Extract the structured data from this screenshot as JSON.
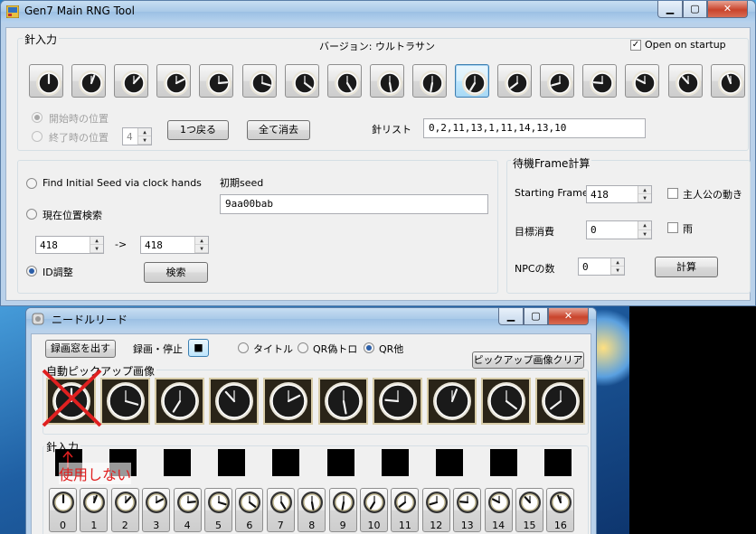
{
  "main_window": {
    "title": "Gen7 Main RNG Tool",
    "caption_min": "▁",
    "caption_max": "▢",
    "caption_close": "✕",
    "needle_group_label": "針入力",
    "version_label": "バージョン: ウルトラサン",
    "open_on_startup_label": "Open on startup",
    "open_on_startup_checked": true,
    "clock_buttons": [
      {
        "index": 0,
        "selected": false
      },
      {
        "index": 1,
        "selected": false
      },
      {
        "index": 2,
        "selected": false
      },
      {
        "index": 3,
        "selected": false
      },
      {
        "index": 4,
        "selected": false
      },
      {
        "index": 5,
        "selected": false
      },
      {
        "index": 6,
        "selected": false
      },
      {
        "index": 7,
        "selected": false
      },
      {
        "index": 8,
        "selected": false
      },
      {
        "index": 9,
        "selected": false
      },
      {
        "index": 10,
        "selected": true
      },
      {
        "index": 11,
        "selected": false
      },
      {
        "index": 12,
        "selected": false
      },
      {
        "index": 13,
        "selected": false
      },
      {
        "index": 14,
        "selected": false
      },
      {
        "index": 15,
        "selected": false
      },
      {
        "index": 16,
        "selected": false
      }
    ],
    "start_position_label": "開始時の位置",
    "end_position_label": "終了時の位置",
    "end_position_value": "4",
    "back_one_button": "1つ戻る",
    "clear_all_button": "全て消去",
    "needle_list_label": "針リスト",
    "needle_list_value": "0,2,11,13,1,11,14,13,10",
    "find_seed_option": "Find Initial Seed via clock hands",
    "current_position_option": "現在位置検索",
    "id_adjust_option": "ID調整",
    "initial_seed_label": "初期seed",
    "initial_seed_value": "9aa00bab",
    "range_from": "418",
    "range_arrow": "->",
    "range_to": "418",
    "search_button": "検索",
    "wait_group_label": "待機Frame計算",
    "starting_frame_label": "Starting Frame",
    "starting_frame_value": "418",
    "target_consumption_label": "目標消費",
    "target_consumption_value": "0",
    "npc_count_label": "NPCの数",
    "npc_count_value": "0",
    "calc_button": "計算",
    "protagonist_motion_label": "主人公の動き",
    "rain_label": "雨"
  },
  "needle_window": {
    "title": "ニードルリード",
    "show_record_window_button": "録画窓を出す",
    "record_toggle_label": "録画・停止",
    "record_toggle_button": "■",
    "mode_options": [
      {
        "label": "タイトル",
        "selected": false
      },
      {
        "label": "QR偽トロ",
        "selected": false
      },
      {
        "label": "QR他",
        "selected": true
      }
    ],
    "clear_pickup_button": "ピックアップ画像クリア",
    "auto_pickup_label": "自動ピックアップ画像",
    "needle_input_label": "針入力",
    "annotation_text": "使用しない",
    "annotation_color": "#e02020",
    "hand_buttons": [
      "0",
      "1",
      "2",
      "3",
      "4",
      "5",
      "6",
      "7",
      "8",
      "9",
      "10",
      "11",
      "12",
      "13",
      "14",
      "15",
      "16"
    ]
  }
}
